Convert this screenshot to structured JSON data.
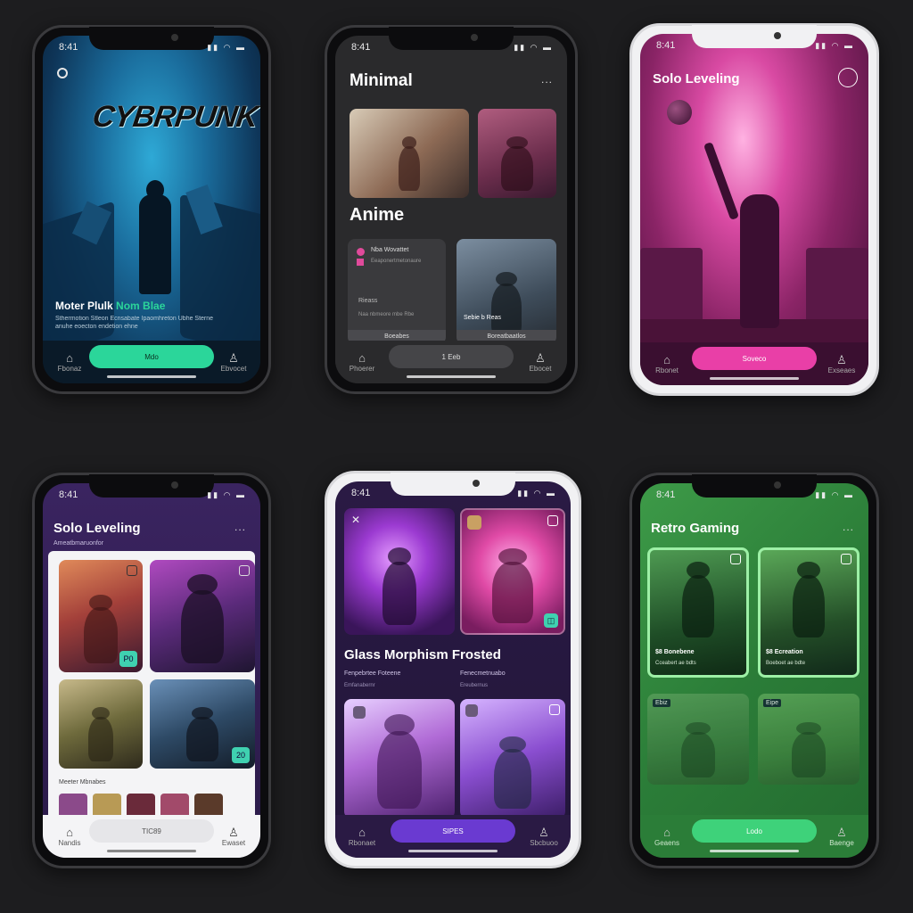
{
  "phones": {
    "cyberpunk": {
      "status_time": "8:41",
      "logo": "CYBRPUNK",
      "caption_title": "Moter Plulk",
      "caption_highlight": "Nom Blae",
      "caption_line1": "Sthermotion Stleon Ecnsabate Ipaomhreton Ubhe Sterne",
      "caption_line2": "anuhe eoecton endetion ehne",
      "pill_label": "Mdo",
      "nav_left": "Fbonaz",
      "nav_right": "Ebvocet",
      "icons": [
        "search-icon",
        "bell-icon",
        "user-icon"
      ],
      "accent": "#2bd69a"
    },
    "minimal": {
      "status_time": "8:41",
      "title": "Minimal",
      "more": "...",
      "section": "Anime",
      "card_title": "Nba Wovattet",
      "card_sub": "Eeaponertmetonaure",
      "card_note": "Rieass",
      "card_note_sub": "Naa nbmeore mbe Rbe",
      "card2_label": "Sebie b Reas",
      "card_btn1": "Boeabes",
      "card_btn2": "Boreatbaatlos",
      "pill_label": "1 Eeb",
      "nav_left": "Phoerer",
      "nav_right": "Ebocet"
    },
    "solo_pink": {
      "status_time": "8:41",
      "title": "Solo Leveling",
      "pill_label": "Soveco",
      "nav_left": "Rbonet",
      "nav_right": "Exseaes",
      "accent": "#e93fa7"
    },
    "solo_list": {
      "status_time": "8:41",
      "title": "Solo Leveling",
      "subtitle": "Ameatbmaruonfor",
      "more": "...",
      "badge1": "P0",
      "badge2": "20",
      "row_label": "Meeter Mbnabes",
      "pill_label": "TIC89",
      "nav_left": "Nandis",
      "nav_right": "Ewaset"
    },
    "glass": {
      "status_time": "8:41",
      "title": "Glass Morphism Frosted",
      "col1_line1": "Fenpebrtee Foteene",
      "col1_line2": "Emfanabernr",
      "col2_line1": "Fenecmetnuabo",
      "col2_line2": "Ereubernus",
      "pill_label": "SIPES",
      "nav_left": "Rbonaet",
      "nav_right": "Sbcbuoo",
      "accent": "#6a3ad1"
    },
    "retro": {
      "status_time": "8:41",
      "title": "Retro Gaming",
      "more": "...",
      "card1_title": "$8 Bonebene",
      "card1_sub": "Cceabert ae bdts",
      "card2_title": "$8 Ecreation",
      "card2_sub": "Boeboet ae bdte",
      "tag1": "Ebiz",
      "tag2": "Eipe",
      "pill_label": "Lodo",
      "nav_left": "Geaens",
      "nav_right": "Baenge",
      "accent": "#3ed27a"
    }
  }
}
